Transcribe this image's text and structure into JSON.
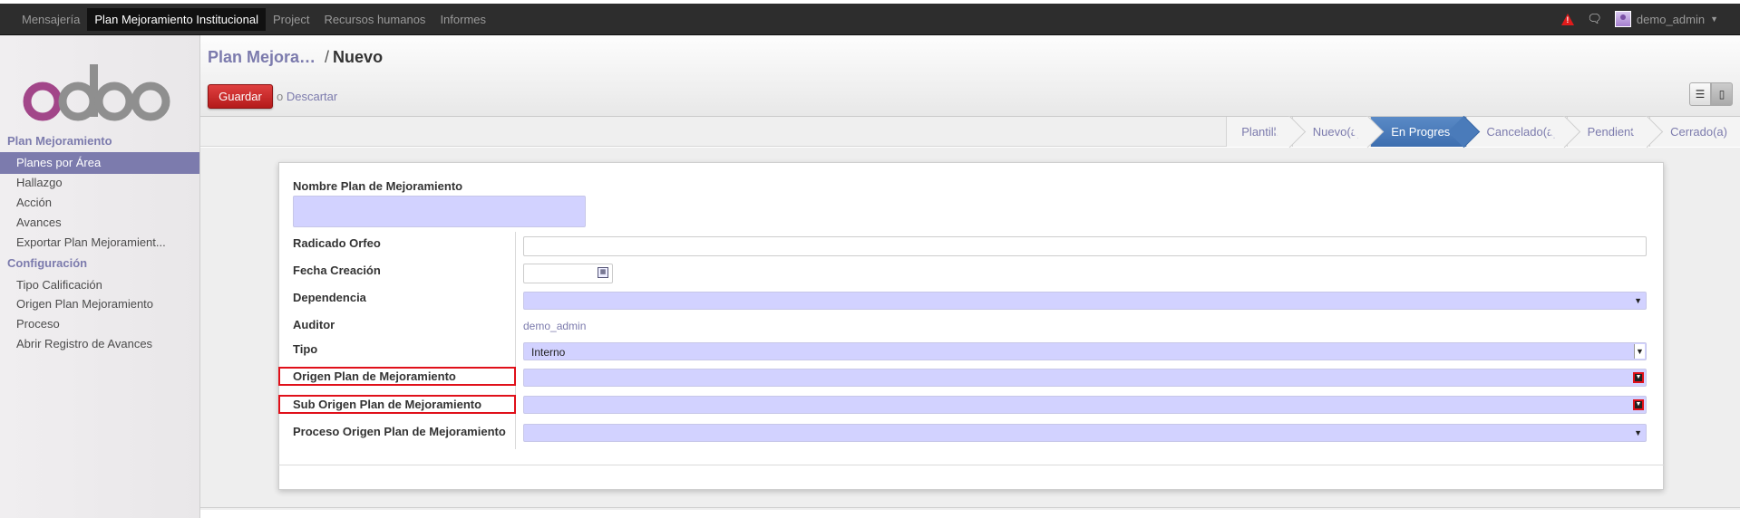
{
  "topbar": {
    "menu": [
      "Mensajería",
      "Plan Mejoramiento Institucional",
      "Project",
      "Recursos humanos",
      "Informes"
    ],
    "active_index": 1,
    "user": "demo_admin"
  },
  "sidebar": {
    "sections": [
      {
        "title": "Plan Mejoramiento",
        "items": [
          "Planes por Área",
          "Hallazgo",
          "Acción",
          "Avances",
          "Exportar Plan Mejoramient..."
        ]
      },
      {
        "title": "Configuración",
        "items": [
          "Tipo Calificación",
          "Origen Plan Mejoramiento",
          "Proceso",
          "Abrir Registro de Avances"
        ]
      }
    ],
    "active_item": "Planes por Área"
  },
  "header": {
    "breadcrumb_prev": "Plan Mejora…",
    "breadcrumb_sep": "/",
    "breadcrumb_current": "Nuevo",
    "save_label": "Guardar",
    "discard_prefix": "o",
    "discard_label": "Descartar"
  },
  "status": {
    "stages": [
      "Plantilla",
      "Nuevo(a)",
      "En Progreso",
      "Cancelado(a)",
      "Pendiente",
      "Cerrado(a)"
    ],
    "current": "En Progreso"
  },
  "form": {
    "name_label": "Nombre Plan de Mejoramiento",
    "fields": {
      "radicado": {
        "label": "Radicado Orfeo",
        "value": ""
      },
      "fecha": {
        "label": "Fecha Creación",
        "value": ""
      },
      "dependencia": {
        "label": "Dependencia",
        "value": ""
      },
      "auditor": {
        "label": "Auditor",
        "value": "demo_admin"
      },
      "tipo": {
        "label": "Tipo",
        "value": "Interno"
      },
      "origen": {
        "label": "Origen Plan de Mejoramiento",
        "value": ""
      },
      "suborigen": {
        "label": "Sub Origen Plan de Mejoramiento",
        "value": ""
      },
      "proceso": {
        "label": "Proceso Origen Plan de Mejoramiento",
        "value": ""
      }
    }
  },
  "colors": {
    "accent": "#7c7bad",
    "save": "#c42a2a",
    "current_stage": "#4a7bba",
    "required_field": "#d2d2ff",
    "highlight": "#e0101a"
  },
  "icons": [
    "warning-icon",
    "chat-icon",
    "user-avatar",
    "list-view-icon",
    "form-view-icon",
    "calendar-icon",
    "dropdown-arrow-icon"
  ]
}
